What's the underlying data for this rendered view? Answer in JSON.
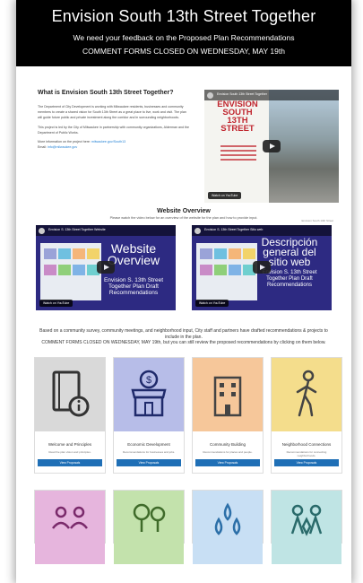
{
  "header": {
    "title": "Envision South 13th Street Together",
    "subtitle": "We need your feedback on the Proposed Plan Recommendations",
    "notice": "COMMENT FORMS CLOSED ON WEDNESDAY, MAY 19th"
  },
  "what": {
    "title": "What is Envision South 13th Street Together?",
    "para1": "The Department of City Development is working with Milwaukee residents, businesses and community members to create a shared vision for South 13th Street as a great place to live, work and visit. The plan will guide future public and private investment along the corridor and in surrounding neighborhoods.",
    "para2": "This project is led by the City of Milwaukee in partnership with community organizations, Alderman and the Department of Public Works.",
    "para3_prefix": "More information on the project here:",
    "para3_link": "milwaukee.gov/South13",
    "para4_prefix": "Email:",
    "para4_link": "info@milwaukee.gov"
  },
  "video1": {
    "bar_text": "Envision South 13th Street Together",
    "poster_title": "ENVISION SOUTH 13TH STREET",
    "watch": "Watch on YouTube",
    "caption": "Envision South 13th Street"
  },
  "overview": {
    "title": "Website Overview",
    "text": "Please watch the video below for an overview of the website for the plan and how to provide input."
  },
  "video2": {
    "bar_text": "Envision S. 13th Street Together Website",
    "big": "Website Overview",
    "small": "Envision S. 13th Street Together Plan Draft Recommendations",
    "watch": "Watch on YouTube"
  },
  "video3": {
    "bar_text": "Envision S. 13th Street Together Sitio web",
    "big": "Descripción general del sitio web",
    "small": "Envision S. 13th Street Together Plan Draft Recommendations",
    "watch": "Watch on YouTube"
  },
  "intro": {
    "line1": "Based on a community survey, community meetings, and neighborhood input, City staff and partners have drafted recommendations & projects to include in the plan.",
    "line2": "COMMENT FORMS CLOSED ON WEDNESDAY, MAY 19th, but you can still review the proposed recommendations by clicking on them below."
  },
  "cards": [
    {
      "name": "Welcome and Principles",
      "desc": "Read the plan vision and principles.",
      "button": "View Proposals",
      "color": "#d9d9d9",
      "icon": "book-info-icon"
    },
    {
      "name": "Economic Development",
      "desc": "Recommendations for businesses and jobs.",
      "button": "View Proposals",
      "color": "#b7bde8",
      "icon": "storefront-icon"
    },
    {
      "name": "Community Building",
      "desc": "Recommendations for places and people.",
      "button": "View Proposals",
      "color": "#f6c79a",
      "icon": "building-icon"
    },
    {
      "name": "Neighborhood Connections",
      "desc": "Recommendations for connecting neighborhoods.",
      "button": "View Proposals",
      "color": "#f4dd8c",
      "icon": "walking-icon"
    },
    {
      "name": "",
      "desc": "",
      "button": "",
      "color": "#e6b5dd",
      "icon": "people-icon"
    },
    {
      "name": "",
      "desc": "",
      "button": "",
      "color": "#c3e2ac",
      "icon": "park-icon"
    },
    {
      "name": "",
      "desc": "",
      "button": "",
      "color": "#c8dff4",
      "icon": "water-drops-icon"
    },
    {
      "name": "",
      "desc": "",
      "button": "",
      "color": "#bfe4e4",
      "icon": "health-icon"
    }
  ]
}
